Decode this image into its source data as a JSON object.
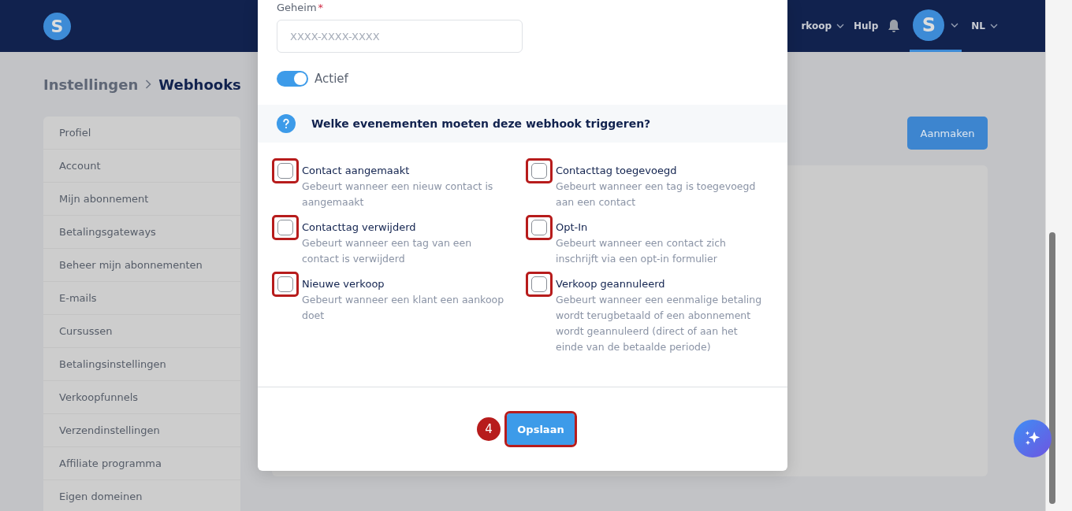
{
  "header": {
    "logo": "S",
    "nav": [
      {
        "label": "rkoop",
        "dropdown": true
      },
      {
        "label": "Hulp",
        "dropdown": false
      }
    ],
    "avatar": "S",
    "language": "NL"
  },
  "breadcrumb": {
    "parent": "Instellingen",
    "current": "Webhooks"
  },
  "sidebar": {
    "items": [
      {
        "label": "Profiel"
      },
      {
        "label": "Account"
      },
      {
        "label": "Mijn abonnement"
      },
      {
        "label": "Betalingsgateways"
      },
      {
        "label": "Beheer mijn abonnementen"
      },
      {
        "label": "E-mails"
      },
      {
        "label": "Cursussen"
      },
      {
        "label": "Betalingsinstellingen"
      },
      {
        "label": "Verkoopfunnels"
      },
      {
        "label": "Verzendinstellingen"
      },
      {
        "label": "Affiliate programma"
      },
      {
        "label": "Eigen domeinen"
      }
    ]
  },
  "create_button": "Aanmaken",
  "modal": {
    "secret": {
      "label": "Geheim",
      "required_mark": "*",
      "placeholder": "XXXX-XXXX-XXXX"
    },
    "active": {
      "label": "Actief",
      "on": true
    },
    "events_heading": "Welke evenementen moeten deze webhook triggeren?",
    "events": [
      {
        "label": "Contact aangemaakt",
        "description": "Gebeurt wanneer een nieuw contact is aangemaakt",
        "checked": false,
        "highlighted": true
      },
      {
        "label": "Contacttag toegevoegd",
        "description": "Gebeurt wanneer een tag is toegevoegd aan een contact",
        "checked": false,
        "highlighted": true
      },
      {
        "label": "Contacttag verwijderd",
        "description": "Gebeurt wanneer een tag van een contact is verwijderd",
        "checked": false,
        "highlighted": true
      },
      {
        "label": "Opt-In",
        "description": "Gebeurt wanneer een contact zich inschrijft via een opt-in formulier",
        "checked": false,
        "highlighted": true
      },
      {
        "label": "Nieuwe verkoop",
        "description": "Gebeurt wanneer een klant een aankoop doet",
        "checked": false,
        "highlighted": true
      },
      {
        "label": "Verkoop geannuleerd",
        "description": "Gebeurt wanneer een eenmalige betaling wordt terugbetaald of een abonnement wordt geannuleerd (direct of aan het einde van de betaalde periode)",
        "checked": false,
        "highlighted": true
      }
    ],
    "step_badge": "4",
    "save_button": {
      "label": "Opslaan",
      "highlighted": true
    }
  }
}
